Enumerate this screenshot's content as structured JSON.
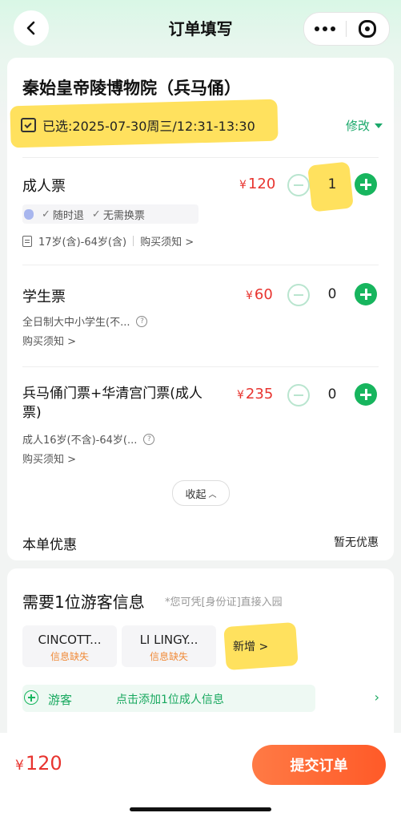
{
  "header": {
    "title": "订单填写"
  },
  "order": {
    "venue": "秦始皇帝陵博物院（兵马俑）",
    "selected_time": "已选:2025-07-30周三/12:31-13:30",
    "modify_label": "修改"
  },
  "tickets": [
    {
      "name": "成人票",
      "currency": "¥",
      "price": "120",
      "qty": "1",
      "tags": [
        "随时退",
        "无需换票"
      ],
      "age": "17岁(含)-64岁(含)",
      "notice": "购买须知 >"
    },
    {
      "name": "学生票",
      "currency": "¥",
      "price": "60",
      "qty": "0",
      "desc": "全日制大中小学生(不...",
      "notice": "购买须知 >"
    },
    {
      "name": "兵马俑门票+华清宫门票(成人票)",
      "currency": "¥",
      "price": "235",
      "qty": "0",
      "desc": "成人16岁(不含)-64岁(...",
      "notice": "购买须知 >"
    }
  ],
  "collapse_label": "收起",
  "discount": {
    "label": "本单优惠",
    "value": "暂无优惠"
  },
  "visitors": {
    "title": "需要1位游客信息",
    "hint": "*您可凭[身份证]直接入园",
    "people": [
      {
        "name": "CINCOTT...",
        "status": "信息缺失"
      },
      {
        "name": "LI LINGY...",
        "status": "信息缺失"
      }
    ],
    "add_label": "新增 >",
    "guest_label": "游客",
    "guest_action": "点击添加1位成人信息",
    "guest_chevron": "›"
  },
  "footer": {
    "currency": "¥",
    "total": "120",
    "submit_label": "提交订单"
  },
  "colors": {
    "accent_green": "#17b55e",
    "price_red": "#e8342f",
    "submit_orange": "#ff6a35",
    "highlight_yellow": "#ffd728"
  }
}
